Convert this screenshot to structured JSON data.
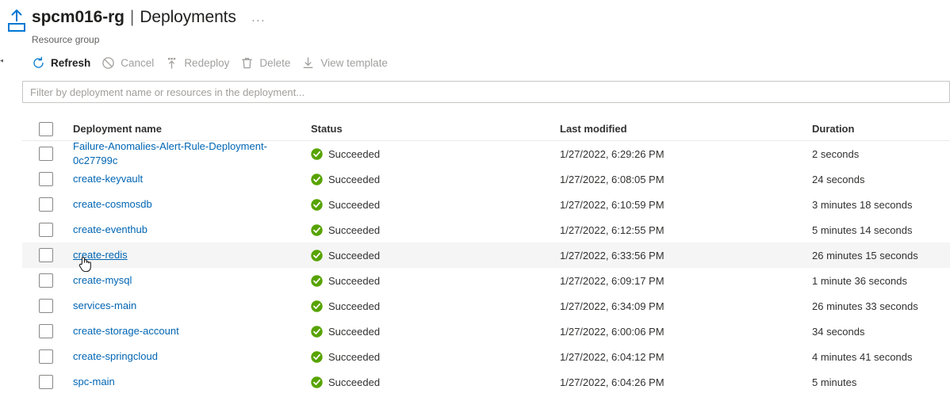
{
  "header": {
    "resource_icon": "resource-group-icon",
    "title": "spcm016-rg",
    "separator": "|",
    "page": "Deployments",
    "ellipsis": "···",
    "subtitle": "Resource group"
  },
  "command_bar": {
    "items": [
      {
        "label": "Refresh",
        "icon": "refresh-icon",
        "enabled": true
      },
      {
        "label": "Cancel",
        "icon": "cancel-icon",
        "enabled": false
      },
      {
        "label": "Redeploy",
        "icon": "redeploy-icon",
        "enabled": false
      },
      {
        "label": "Delete",
        "icon": "delete-trash-icon",
        "enabled": false
      },
      {
        "label": "View template",
        "icon": "download-icon",
        "enabled": false
      }
    ]
  },
  "filter": {
    "value": "",
    "placeholder": "Filter by deployment name or resources in the deployment..."
  },
  "table": {
    "columns": {
      "name": "Deployment name",
      "status": "Status",
      "modified": "Last modified",
      "duration": "Duration"
    },
    "rows": [
      {
        "name": "Failure-Anomalies-Alert-Rule-Deployment-0c27799c",
        "status": "Succeeded",
        "modified": "1/27/2022, 6:29:26 PM",
        "duration": "2 seconds",
        "hovered": false
      },
      {
        "name": "create-keyvault",
        "status": "Succeeded",
        "modified": "1/27/2022, 6:08:05 PM",
        "duration": "24 seconds",
        "hovered": false
      },
      {
        "name": "create-cosmosdb",
        "status": "Succeeded",
        "modified": "1/27/2022, 6:10:59 PM",
        "duration": "3 minutes 18 seconds",
        "hovered": false
      },
      {
        "name": "create-eventhub",
        "status": "Succeeded",
        "modified": "1/27/2022, 6:12:55 PM",
        "duration": "5 minutes 14 seconds",
        "hovered": false
      },
      {
        "name": "create-redis",
        "status": "Succeeded",
        "modified": "1/27/2022, 6:33:56 PM",
        "duration": "26 minutes 15 seconds",
        "hovered": true
      },
      {
        "name": "create-mysql",
        "status": "Succeeded",
        "modified": "1/27/2022, 6:09:17 PM",
        "duration": "1 minute 36 seconds",
        "hovered": false
      },
      {
        "name": "services-main",
        "status": "Succeeded",
        "modified": "1/27/2022, 6:34:09 PM",
        "duration": "26 minutes 33 seconds",
        "hovered": false
      },
      {
        "name": "create-storage-account",
        "status": "Succeeded",
        "modified": "1/27/2022, 6:00:06 PM",
        "duration": "34 seconds",
        "hovered": false
      },
      {
        "name": "create-springcloud",
        "status": "Succeeded",
        "modified": "1/27/2022, 6:04:12 PM",
        "duration": "4 minutes 41 seconds",
        "hovered": false
      },
      {
        "name": "spc-main",
        "status": "Succeeded",
        "modified": "1/27/2022, 6:04:26 PM",
        "duration": "5 minutes",
        "hovered": false
      }
    ]
  },
  "colors": {
    "link": "#0065b3",
    "accent": "#0078d4",
    "success": "#57a300",
    "disabled_text": "#a19f9d",
    "hover_row": "#f5f5f5"
  }
}
